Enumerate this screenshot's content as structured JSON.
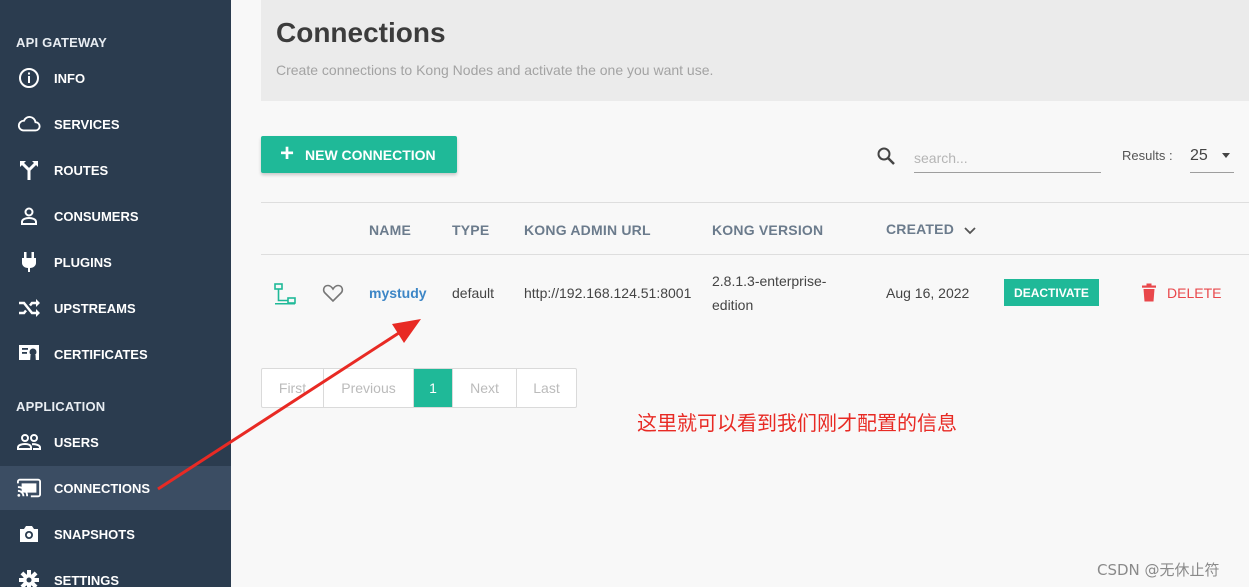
{
  "sidebar": {
    "sections": [
      {
        "title": "API GATEWAY"
      },
      {
        "title": "APPLICATION"
      }
    ],
    "items": [
      {
        "label": "INFO",
        "icon": "info-icon"
      },
      {
        "label": "SERVICES",
        "icon": "cloud-icon"
      },
      {
        "label": "ROUTES",
        "icon": "routes-icon"
      },
      {
        "label": "CONSUMERS",
        "icon": "person-icon"
      },
      {
        "label": "PLUGINS",
        "icon": "plug-icon"
      },
      {
        "label": "UPSTREAMS",
        "icon": "shuffle-icon"
      },
      {
        "label": "CERTIFICATES",
        "icon": "certificate-icon"
      },
      {
        "label": "USERS",
        "icon": "users-icon"
      },
      {
        "label": "CONNECTIONS",
        "icon": "cast-icon",
        "active": true
      },
      {
        "label": "SNAPSHOTS",
        "icon": "camera-icon"
      },
      {
        "label": "SETTINGS",
        "icon": "gear-icon"
      }
    ]
  },
  "header": {
    "title": "Connections",
    "subtitle": "Create connections to Kong Nodes and activate the one you want use."
  },
  "toolbar": {
    "new_connection_label": "NEW CONNECTION",
    "search_placeholder": "search...",
    "results_label": "Results :",
    "results_value": "25"
  },
  "table": {
    "columns": [
      "NAME",
      "TYPE",
      "KONG ADMIN URL",
      "KONG VERSION",
      "CREATED"
    ],
    "rows": [
      {
        "name": "mystudy",
        "type": "default",
        "kong_admin_url": "http://192.168.124.51:8001",
        "kong_version_line1": "2.8.1.3-enterprise-",
        "kong_version_line2": "edition",
        "created": "Aug 16, 2022",
        "deactivate_label": "DEACTIVATE",
        "delete_label": "DELETE"
      }
    ]
  },
  "pagination": {
    "first": "First",
    "previous": "Previous",
    "current": "1",
    "next": "Next",
    "last": "Last"
  },
  "annotation_text": "这里就可以看到我们刚才配置的信息",
  "watermark": "CSDN @无休止符",
  "colors": {
    "sidebar_bg": "#2b3c4f",
    "accent": "#1fb998",
    "link": "#3d86c6",
    "danger": "#e9474b",
    "annotation": "#e82a24"
  }
}
